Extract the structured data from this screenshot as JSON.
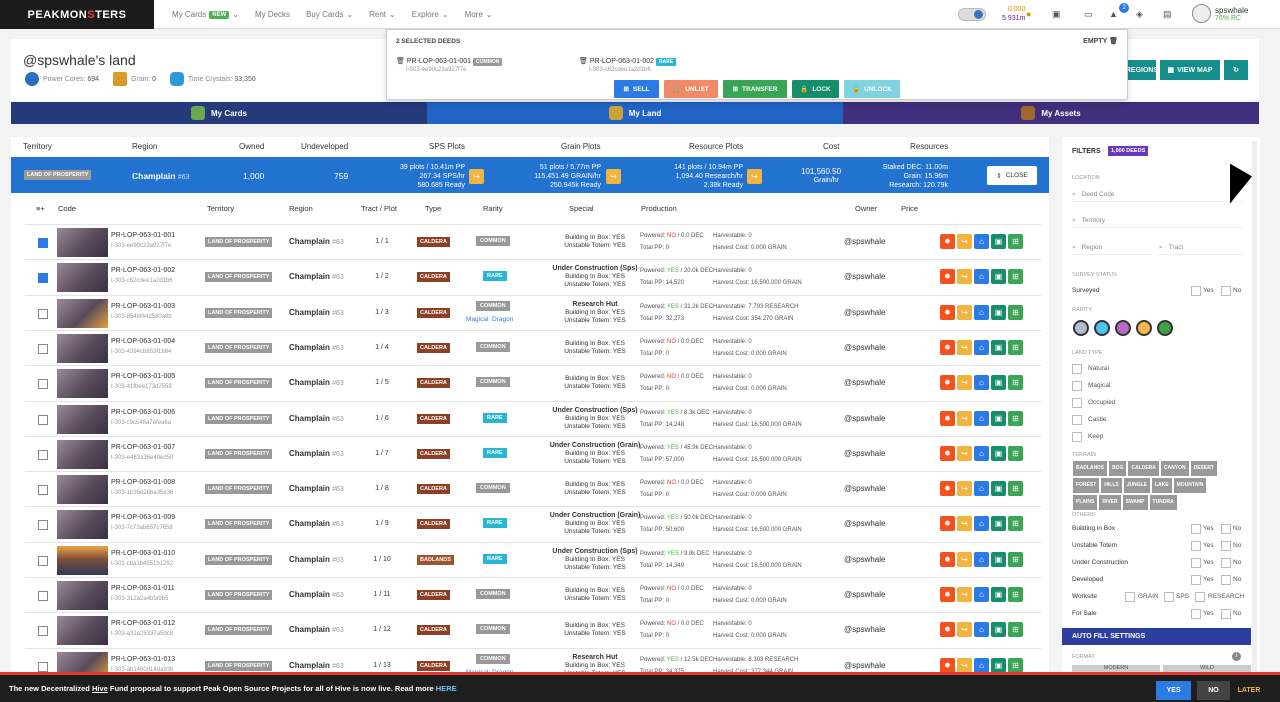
{
  "nav": {
    "logo_pre": "PEAKMON",
    "logo_mid": "S",
    "logo_post": "TERS",
    "items": [
      "My Cards",
      "My Decks",
      "Buy Cards",
      "Rent",
      "Explore",
      "More"
    ],
    "new_badge": "NEW"
  },
  "balance": {
    "dec": "0.000",
    "sps": "5.931m"
  },
  "notif_count": "2",
  "user": {
    "name": "spswhale",
    "rc": "76% RC"
  },
  "land": {
    "title": "@spswhale's land",
    "power_label": "Power Cores:",
    "power": "694",
    "grain_label": "Grain:",
    "grain": "0",
    "tc_label": "Time Crystals:",
    "tc": "33,350"
  },
  "buttons": {
    "regions": "REGIONS",
    "view_map": "VIEW MAP",
    "plus_e": "E"
  },
  "tabs": [
    "My Cards",
    "My Land",
    "My Assets"
  ],
  "dropdown": {
    "title": "2 SELECTED DEEDS",
    "empty": "EMPTY",
    "deeds": [
      {
        "code": "PR-LOP-063-01-001",
        "rarity": "COMMON",
        "hash": "I-303-ee90c23a927f7e"
      },
      {
        "code": "PR-LOP-063-01-002",
        "rarity": "RARE",
        "hash": "I-303-c62cdee1a2d1b6"
      }
    ],
    "actions": [
      "SELL",
      "UNLIST",
      "TRANSFER",
      "LOCK",
      "UNLOCK"
    ]
  },
  "columns": [
    "Territory",
    "Region",
    "Owned",
    "Undeveloped",
    "SPS Plots",
    "Grain Plots",
    "Resource Plots",
    "Cost",
    "Resources"
  ],
  "summary": {
    "territory": "LAND OF PROSPERITY",
    "region": "Champlain",
    "region_num": "#63",
    "owned": "1,000",
    "undeveloped": "759",
    "sps": [
      "39 plots / 10.41m PP",
      "267.34 SPS/hr",
      "580.685 Ready"
    ],
    "grain": [
      "51 plots / 5.77m PP",
      "115,451.49 GRAIN/hr",
      "250.945k Ready"
    ],
    "res": [
      "141 plots / 10.94m PP",
      "1,094.40 Research/hr",
      "2.38k Ready"
    ],
    "cost": [
      "101,560.50",
      "Grain/hr"
    ],
    "resources": [
      "Staked DEC: 11.00m",
      "Grain: 15.96m",
      "Research: 120.79k"
    ],
    "close": "CLOSE"
  },
  "table_headers": [
    "Code",
    "Territory",
    "Region",
    "Tract / Plot",
    "Type",
    "Rarity",
    "Special",
    "Production",
    "Owner",
    "Price"
  ],
  "rows": [
    {
      "code": "PR-LOP-063-01-001",
      "hash": "I-303-ee90c23a927f7e",
      "checked": true,
      "terr": "LAND OF PROSPERITY",
      "region": "Champlain",
      "rnum": "#63",
      "tp": "1 / 1",
      "type": "CALDERA",
      "rarity": "COMMON",
      "magic": "",
      "spec": [
        "",
        "Building In Box: YES",
        "Unstable Totem: YES"
      ],
      "pw": "NO",
      "pv": "0.0 DEC",
      "tpp": "0",
      "harv": "Harvestable: 0",
      "hc": "Harvest Cost: 0.000 GRAIN",
      "owner": "@spswhale"
    },
    {
      "code": "PR-LOP-063-01-002",
      "hash": "I-303-c62cdee1a2d1b6",
      "checked": true,
      "terr": "LAND OF PROSPERITY",
      "region": "Champlain",
      "rnum": "#63",
      "tp": "1 / 2",
      "type": "CALDERA",
      "rarity": "RARE",
      "magic": "",
      "spec": [
        "Under Construction (Sps)",
        "Building In Box: YES",
        "Unstable Totem: YES"
      ],
      "pw": "YES",
      "pv": "20.0k DEC",
      "tpp": "14,520",
      "harv": "Harvestable: 0",
      "hc": "Harvest Cost: 16,500.000 GRAIN",
      "owner": "@spswhale"
    },
    {
      "code": "PR-LOP-063-01-003",
      "hash": "I-303-854bf442580a8b",
      "checked": false,
      "terr": "LAND OF PROSPERITY",
      "region": "Champlain",
      "rnum": "#63",
      "tp": "1 / 3",
      "type": "CALDERA",
      "rarity": "COMMON",
      "magic": "Magical: Dragon",
      "spec": [
        "Research Hut",
        "Building In Box: YES",
        "Unstable Totem: YES"
      ],
      "pw": "YES",
      "pv": "31.2k DEC",
      "tpp": "32,273",
      "harv": "Harvestable: 7.793 RESEARCH",
      "hc": "Harvest Cost: 354.270 GRAIN",
      "owner": "@spswhale"
    },
    {
      "code": "PR-LOP-063-01-004",
      "hash": "I-303-4394cb853f1b84",
      "checked": false,
      "terr": "LAND OF PROSPERITY",
      "region": "Champlain",
      "rnum": "#63",
      "tp": "1 / 4",
      "type": "CALDERA",
      "rarity": "COMMON",
      "magic": "",
      "spec": [
        "",
        "Building In Box: YES",
        "Unstable Totem: YES"
      ],
      "pw": "NO",
      "pv": "0.0 DEC",
      "tpp": "0",
      "harv": "Harvestable: 0",
      "hc": "Harvest Cost: 0.000 GRAIN",
      "owner": "@spswhale"
    },
    {
      "code": "PR-LOP-063-01-005",
      "hash": "I-303-41fbee173d7559",
      "checked": false,
      "terr": "LAND OF PROSPERITY",
      "region": "Champlain",
      "rnum": "#63",
      "tp": "1 / 5",
      "type": "CALDERA",
      "rarity": "COMMON",
      "magic": "",
      "spec": [
        "",
        "Building In Box: YES",
        "Unstable Totem: YES"
      ],
      "pw": "NO",
      "pv": "0.0 DEC",
      "tpp": "0",
      "harv": "Harvestable: 0",
      "hc": "Harvest Cost: 0.000 GRAIN",
      "owner": "@spswhale"
    },
    {
      "code": "PR-LOP-063-01-006",
      "hash": "I-303-c9c546a7efea6a",
      "checked": false,
      "terr": "LAND OF PROSPERITY",
      "region": "Champlain",
      "rnum": "#63",
      "tp": "1 / 6",
      "type": "CALDERA",
      "rarity": "RARE",
      "magic": "",
      "spec": [
        "Under Construction (Sps)",
        "Building In Box: YES",
        "Unstable Totem: YES"
      ],
      "pw": "YES",
      "pv": "8.3k DEC",
      "tpp": "14,248",
      "harv": "Harvestable: 0",
      "hc": "Harvest Cost: 16,500.000 GRAIN",
      "owner": "@spswhale"
    },
    {
      "code": "PR-LOP-063-01-007",
      "hash": "I-303-e483a36e49ed50",
      "checked": false,
      "terr": "LAND OF PROSPERITY",
      "region": "Champlain",
      "rnum": "#63",
      "tp": "1 / 7",
      "type": "CALDERA",
      "rarity": "RARE",
      "magic": "",
      "spec": [
        "Under Construction (Grain)",
        "Building In Box: YES",
        "Unstable Totem: YES"
      ],
      "pw": "YES",
      "pv": "45.9k DEC",
      "tpp": "57,000",
      "harv": "Harvestable: 0",
      "hc": "Harvest Cost: 16,500.000 GRAIN",
      "owner": "@spswhale"
    },
    {
      "code": "PR-LOP-063-01-008",
      "hash": "I-303-1b35e26ba35e36",
      "checked": false,
      "terr": "LAND OF PROSPERITY",
      "region": "Champlain",
      "rnum": "#63",
      "tp": "1 / 8",
      "type": "CALDERA",
      "rarity": "COMMON",
      "magic": "",
      "spec": [
        "",
        "Building In Box: YES",
        "Unstable Totem: YES"
      ],
      "pw": "NO",
      "pv": "0.0 DEC",
      "tpp": "0",
      "harv": "Harvestable: 0",
      "hc": "Harvest Cost: 0.000 GRAIN",
      "owner": "@spswhale"
    },
    {
      "code": "PR-LOP-063-01-009",
      "hash": "I-303-7c73ab657c7658",
      "checked": false,
      "terr": "LAND OF PROSPERITY",
      "region": "Champlain",
      "rnum": "#63",
      "tp": "1 / 9",
      "type": "CALDERA",
      "rarity": "RARE",
      "magic": "",
      "spec": [
        "Under Construction (Grain)",
        "Building In Box: YES",
        "Unstable Totem: YES"
      ],
      "pw": "YES",
      "pv": "50.0k DEC",
      "tpp": "50,600",
      "harv": "Harvestable: 0",
      "hc": "Harvest Cost: 16,500.000 GRAIN",
      "owner": "@spswhale"
    },
    {
      "code": "PR-LOP-063-01-010",
      "hash": "I-301-cba1b4551b1292",
      "checked": false,
      "terr": "LAND OF PROSPERITY",
      "region": "Champlain",
      "rnum": "#63",
      "tp": "1 / 10",
      "type": "BADLANDS",
      "rarity": "RARE",
      "magic": "",
      "spec": [
        "Under Construction (Sps)",
        "Building In Box: YES",
        "Unstable Totem: YES"
      ],
      "pw": "YES",
      "pv": "9.8k DEC",
      "tpp": "14,349",
      "harv": "Harvestable: 0",
      "hc": "Harvest Cost: 16,500.000 GRAIN",
      "owner": "@spswhale"
    },
    {
      "code": "PR-LOP-063-01-011",
      "hash": "I-303-312a2a4bfa9b5",
      "checked": false,
      "terr": "LAND OF PROSPERITY",
      "region": "Champlain",
      "rnum": "#63",
      "tp": "1 / 11",
      "type": "CALDERA",
      "rarity": "COMMON",
      "magic": "",
      "spec": [
        "",
        "Building In Box: YES",
        "Unstable Totem: YES"
      ],
      "pw": "NO",
      "pv": "0.0 DEC",
      "tpp": "0",
      "harv": "Harvestable: 0",
      "hc": "Harvest Cost: 0.000 GRAIN",
      "owner": "@spswhale"
    },
    {
      "code": "PR-LOP-063-01-012",
      "hash": "I-303-a31e25337a5dc8",
      "checked": false,
      "terr": "LAND OF PROSPERITY",
      "region": "Champlain",
      "rnum": "#63",
      "tp": "1 / 12",
      "type": "CALDERA",
      "rarity": "COMMON",
      "magic": "",
      "spec": [
        "",
        "Building In Box: YES",
        "Unstable Totem: YES"
      ],
      "pw": "NO",
      "pv": "0.0 DEC",
      "tpp": "0",
      "harv": "Harvestable: 0",
      "hc": "Harvest Cost: 0.000 GRAIN",
      "owner": "@spswhale"
    },
    {
      "code": "PR-LOP-063-01-013",
      "hash": "I-303-ab1460d14da93b",
      "checked": false,
      "terr": "LAND OF PROSPERITY",
      "region": "Champlain",
      "rnum": "#63",
      "tp": "1 / 13",
      "type": "CALDERA",
      "rarity": "COMMON",
      "magic": "Magical: Dragon",
      "spec": [
        "Research Hut",
        "Building In Box: YES",
        "Unstable Totem: YES"
      ],
      "pw": "YES",
      "pv": "12.5k DEC",
      "tpp": "34,375",
      "harv": "Harvestable: 8.303 RESEARCH",
      "hc": "Harvest Cost: 377.344 GRAIN",
      "owner": "@spswhale"
    }
  ],
  "filters": {
    "title": "FILTERS",
    "badge": "1,000 DEEDS",
    "location": "LOCATION",
    "deed_code": "Deed Code",
    "territory": "Territory",
    "region": "Region",
    "tract": "Tract",
    "survey_status": "SURVEY STATUS",
    "surveyed": "Surveyed",
    "yes": "Yes",
    "no": "No",
    "rarity": "RARITY",
    "land_type": "LAND TYPE",
    "land_types": [
      "Natural",
      "Magical",
      "Occupied",
      "Castle",
      "Keep"
    ],
    "terrain": "TERRAIN",
    "terrains": [
      "BADLANDS",
      "BOG",
      "CALDERA",
      "CANYON",
      "DESERT",
      "FOREST",
      "HILLS",
      "JUNGLE",
      "LAKE",
      "MOUNTAIN",
      "PLAINS",
      "RIVER",
      "SWAMP",
      "TUNDRA"
    ],
    "others": "OTHERS",
    "others_items": [
      "Building in Box",
      "Unstable Totem",
      "Under Construction",
      "Developed"
    ],
    "worksite": "Worksite",
    "ws": [
      "GRAIN",
      "SPS",
      "RESEARCH"
    ],
    "for_sale": "For Sale",
    "autofill": "AUTO FILL SETTINGS",
    "format": "FORMAT",
    "modern": "MODERN",
    "wild": "WILD"
  },
  "banner": {
    "pre": "The new Decentralized ",
    "hive": "Hive",
    "post": " Fund proposal to support Peak Open Source Projects for all of Hive is now live. Read more ",
    "here": "HERE",
    "yes": "YES",
    "no": "NO",
    "later": "LATER"
  },
  "colors": {
    "blue": "#2272d0",
    "teal": "#168e8c",
    "orange": "#f2b440"
  }
}
